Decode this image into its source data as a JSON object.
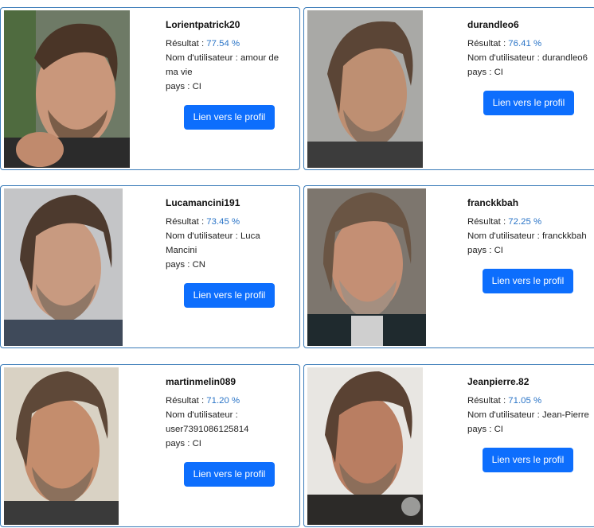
{
  "labels": {
    "score": "Résultat : ",
    "username": "Nom d'utilisateur : ",
    "country": "pays : ",
    "profile_button": "Lien vers le profil"
  },
  "cards": [
    {
      "title": "Lorientpatrick20",
      "score": "77.54 %",
      "username_line1": "amour de",
      "username_line2": "ma vie",
      "country": "CI"
    },
    {
      "title": "durandleo6",
      "score": "76.41 %",
      "username_line1": "durandleo6",
      "username_line2": "",
      "country": "CI"
    },
    {
      "title": "Lucamancini191",
      "score": "73.45 %",
      "username_line1": "Luca",
      "username_line2": "Mancini",
      "country": "CN"
    },
    {
      "title": "franckkbah",
      "score": "72.25 %",
      "username_line1": "franckkbah",
      "username_line2": "",
      "country": "CI"
    },
    {
      "title": "martinmelin089",
      "score": "71.20 %",
      "username_line1": "",
      "username_line2": "user7391086125814",
      "country": "CI"
    },
    {
      "title": "Jeanpierre.82",
      "score": "71.05 %",
      "username_line1": "Jean-Pierre",
      "username_line2": "",
      "country": "CI"
    }
  ]
}
